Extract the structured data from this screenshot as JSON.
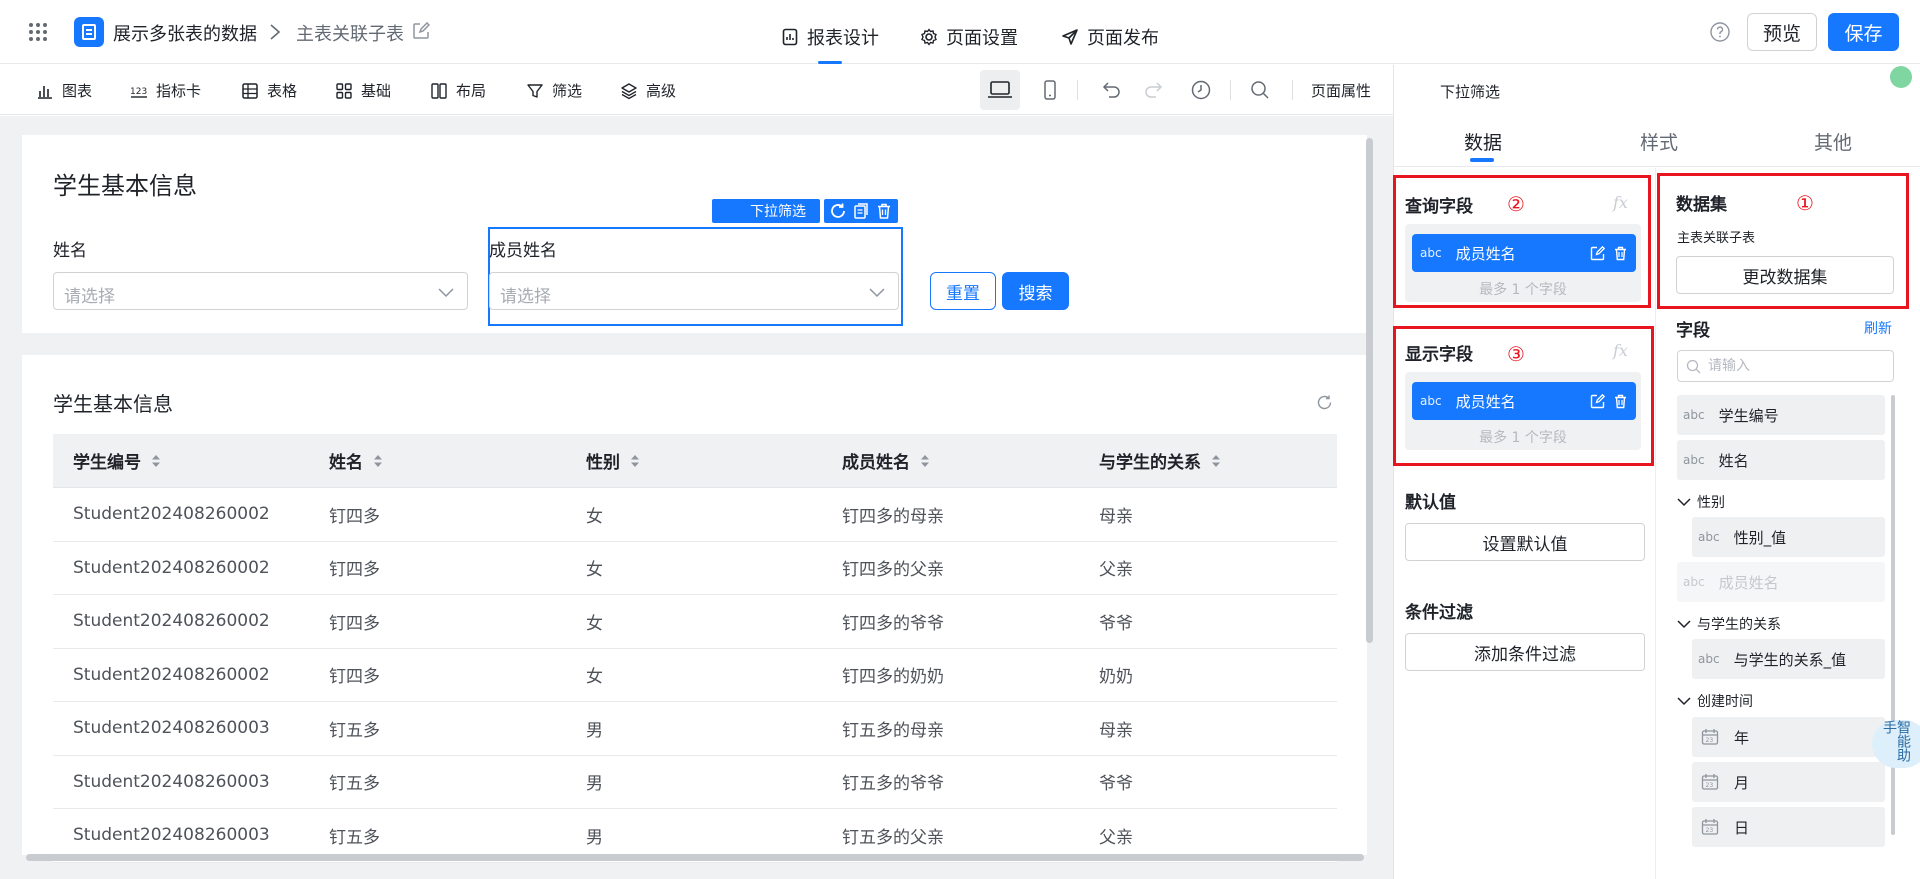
{
  "header": {
    "app_name": "展示多张表的数据",
    "page_name": "主表关联子表",
    "tabs": [
      "报表设计",
      "页面设置",
      "页面发布"
    ],
    "preview_label": "预览",
    "save_label": "保存"
  },
  "toolbar": {
    "items": [
      "图表",
      "指标卡",
      "表格",
      "基础",
      "布局",
      "筛选",
      "高级"
    ],
    "page_props_label": "页面属性"
  },
  "filter_card": {
    "title": "学生基本信息",
    "field1_label": "姓名",
    "field1_placeholder": "请选择",
    "field2_label": "成员姓名",
    "field2_placeholder": "请选择",
    "component_tag": "下拉筛选",
    "reset_label": "重置",
    "search_label": "搜索"
  },
  "table_card": {
    "title": "学生基本信息",
    "columns": [
      "学生编号",
      "姓名",
      "性别",
      "成员姓名",
      "与学生的关系"
    ],
    "rows": [
      [
        "Student202408260002",
        "钉四多",
        "女",
        "钉四多的母亲",
        "母亲"
      ],
      [
        "Student202408260002",
        "钉四多",
        "女",
        "钉四多的父亲",
        "父亲"
      ],
      [
        "Student202408260002",
        "钉四多",
        "女",
        "钉四多的爷爷",
        "爷爷"
      ],
      [
        "Student202408260002",
        "钉四多",
        "女",
        "钉四多的奶奶",
        "奶奶"
      ],
      [
        "Student202408260003",
        "钉五多",
        "男",
        "钉五多的母亲",
        "母亲"
      ],
      [
        "Student202408260003",
        "钉五多",
        "男",
        "钉五多的爷爷",
        "爷爷"
      ],
      [
        "Student202408260003",
        "钉五多",
        "男",
        "钉五多的父亲",
        "父亲"
      ]
    ]
  },
  "panel": {
    "title": "下拉筛选",
    "tabs": [
      "数据",
      "样式",
      "其他"
    ],
    "query_field": {
      "title": "查询字段",
      "marker": "②",
      "fx": "fx",
      "chip_type": "abc",
      "chip_name": "成员姓名",
      "hint": "最多 1 个字段"
    },
    "display_field": {
      "title": "显示字段",
      "marker": "③",
      "fx": "fx",
      "chip_type": "abc",
      "chip_name": "成员姓名",
      "hint": "最多 1 个字段"
    },
    "default_value": {
      "title": "默认值",
      "button": "设置默认值"
    },
    "condition_filter": {
      "title": "条件过滤",
      "button": "添加条件过滤"
    },
    "dataset": {
      "title": "数据集",
      "marker": "①",
      "name": "主表关联子表",
      "change_button": "更改数据集"
    },
    "fields": {
      "title": "字段",
      "refresh_label": "刷新",
      "search_placeholder": "请输入",
      "top_items": [
        {
          "type": "abc",
          "name": "学生编号"
        },
        {
          "type": "abc",
          "name": "姓名"
        }
      ],
      "groups": [
        {
          "name": "性别",
          "items": [
            {
              "type": "abc",
              "name": "性别_值"
            },
            {
              "type": "abc",
              "name": "成员姓名"
            }
          ]
        },
        {
          "name": "与学生的关系",
          "items": [
            {
              "type": "abc",
              "name": "与学生的关系_值"
            }
          ]
        },
        {
          "name": "创建时间",
          "items": [
            {
              "type": "date",
              "name": "年"
            },
            {
              "type": "date",
              "name": "月"
            },
            {
              "type": "date",
              "name": "日"
            }
          ]
        }
      ]
    },
    "float_badge": "智能助手"
  }
}
